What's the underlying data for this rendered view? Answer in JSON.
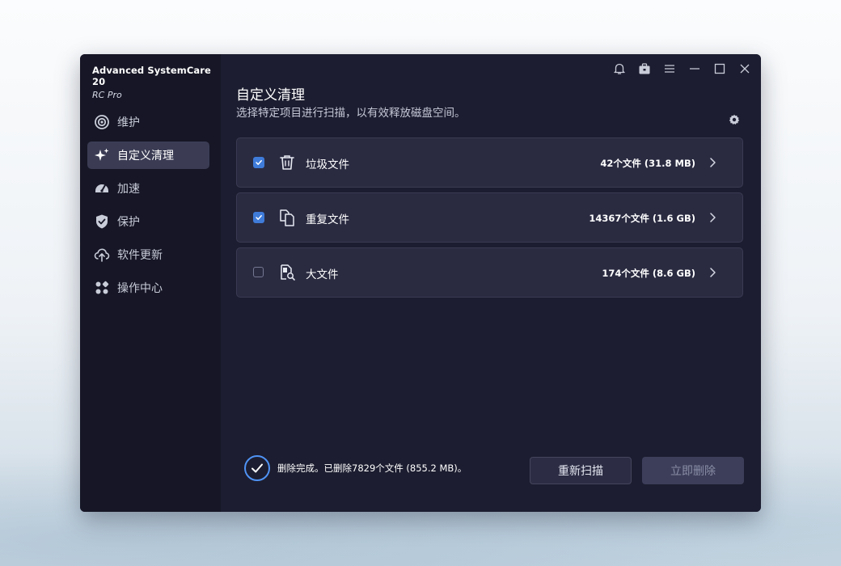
{
  "app": {
    "name": "Advanced SystemCare 20",
    "edition": "RC Pro"
  },
  "sidebar": {
    "items": [
      {
        "label": "维护",
        "icon": "maintain-icon",
        "active": false
      },
      {
        "label": "自定义清理",
        "icon": "sparkle-icon",
        "active": true
      },
      {
        "label": "加速",
        "icon": "speedometer-icon",
        "active": false
      },
      {
        "label": "保护",
        "icon": "shield-icon",
        "active": false
      },
      {
        "label": "软件更新",
        "icon": "cloud-upload-icon",
        "active": false
      },
      {
        "label": "操作中心",
        "icon": "action-center-icon",
        "active": false
      }
    ]
  },
  "toolbar": {
    "icons": [
      "bell-icon",
      "toolbox-icon",
      "menu-icon",
      "minimize-icon",
      "maximize-icon",
      "close-icon"
    ]
  },
  "main": {
    "title": "自定义清理",
    "subtitle": "选择特定项目进行扫描，以有效释放磁盘空间。",
    "settings_icon": "gear-icon",
    "rows": [
      {
        "label": "垃圾文件",
        "count": "42个文件 (31.8 MB)",
        "checked": true,
        "icon": "trash-icon"
      },
      {
        "label": "重复文件",
        "count": "14367个文件 (1.6 GB)",
        "checked": true,
        "icon": "duplicate-files-icon"
      },
      {
        "label": "大文件",
        "count": "174个文件 (8.6 GB)",
        "checked": false,
        "icon": "large-file-search-icon"
      }
    ]
  },
  "footer": {
    "status_text": "删除完成。已删除7829个文件 (855.2 MB)。",
    "rescan_label": "重新扫描",
    "delete_label": "立即删除",
    "delete_enabled": false
  },
  "colors": {
    "window_bg": "#1c1d30",
    "sidebar_bg": "#161626",
    "accent": "#3f7bd9",
    "status_ring": "#4f93f5"
  }
}
